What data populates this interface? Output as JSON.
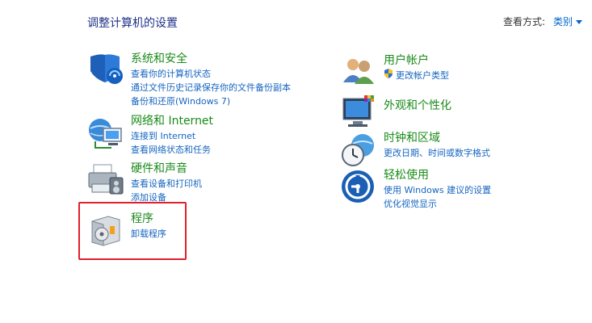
{
  "header": {
    "title": "调整计算机的设置",
    "view_by_label": "查看方式:",
    "view_by_value": "类别"
  },
  "left_column": [
    {
      "id": "system-security",
      "icon": "shield-icon",
      "title": "系统和安全",
      "links": [
        "查看你的计算机状态",
        "通过文件历史记录保存你的文件备份副本",
        "备份和还原(Windows 7)"
      ]
    },
    {
      "id": "network-internet",
      "icon": "network-globe-icon",
      "title": "网络和 Internet",
      "links": [
        "连接到 Internet",
        "查看网络状态和任务"
      ]
    },
    {
      "id": "hardware-sound",
      "icon": "printer-icon",
      "title": "硬件和声音",
      "links": [
        "查看设备和打印机",
        "添加设备"
      ]
    },
    {
      "id": "programs",
      "icon": "programs-icon",
      "title": "程序",
      "links": [
        "卸载程序"
      ]
    }
  ],
  "right_column": [
    {
      "id": "user-accounts",
      "icon": "users-icon",
      "title": "用户帐户",
      "links": [
        "更改帐户类型"
      ]
    },
    {
      "id": "appearance",
      "icon": "monitor-icon",
      "title": "外观和个性化",
      "links": []
    },
    {
      "id": "clock-region",
      "icon": "clock-globe-icon",
      "title": "时钟和区域",
      "links": [
        "更改日期、时间或数字格式"
      ]
    },
    {
      "id": "ease-access",
      "icon": "ease-of-access-icon",
      "title": "轻松使用",
      "links": [
        "使用 Windows 建议的设置",
        "优化视觉显示"
      ]
    }
  ],
  "highlight": {
    "target": "programs",
    "color": "#e0202c"
  }
}
